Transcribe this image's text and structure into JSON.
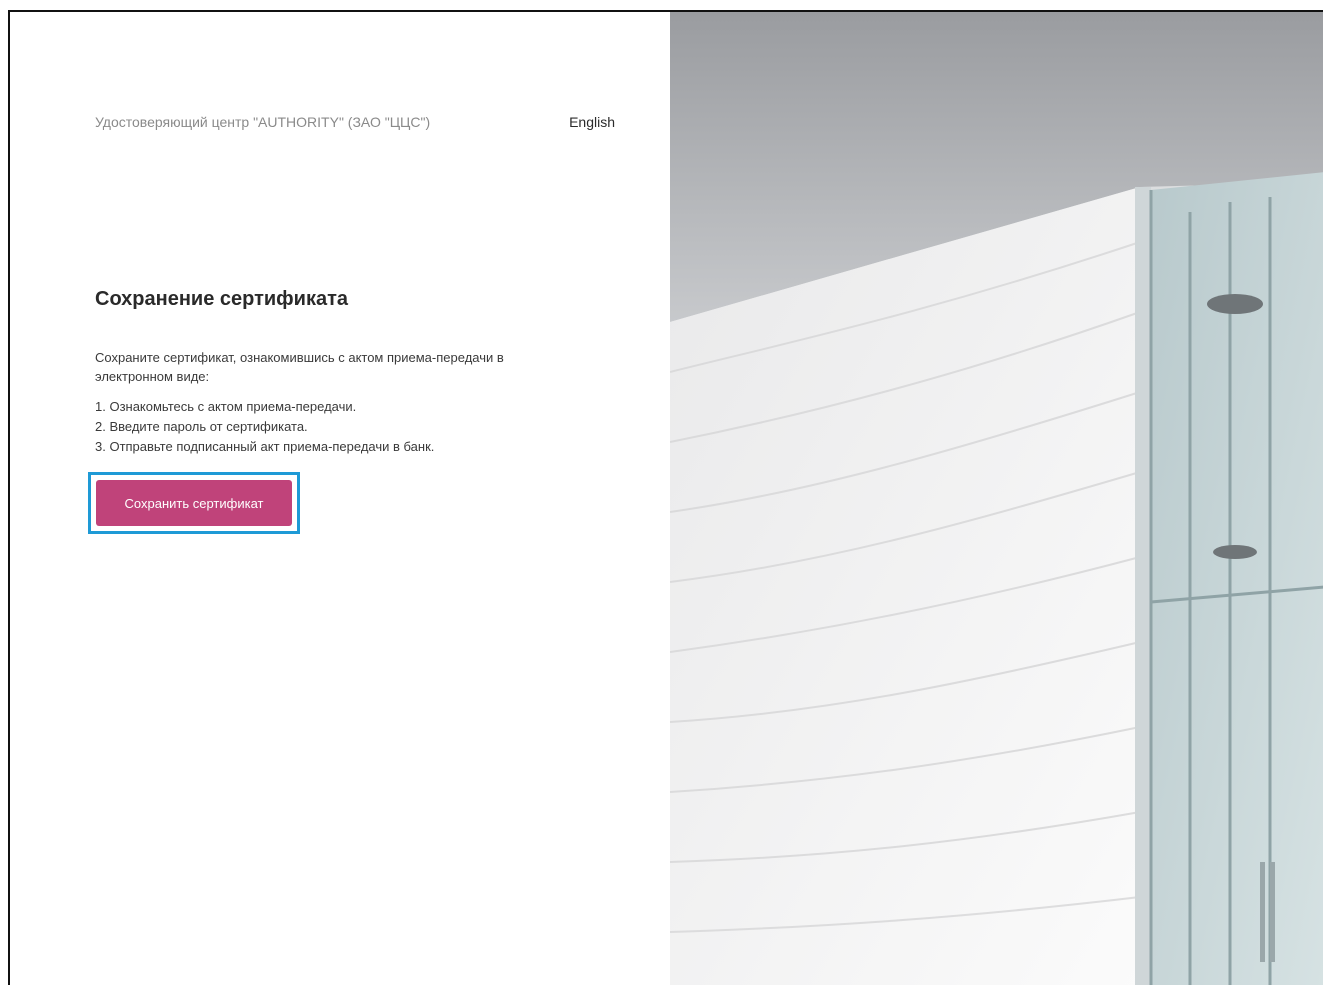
{
  "header": {
    "org_name": "Удостоверяющий центр \"AUTHORITY\" (ЗАО \"ЦЦС\")",
    "language_link": "English"
  },
  "main": {
    "title": "Сохранение сертификата",
    "description": "Сохраните сертификат, ознакомившись с актом приема-передачи в электронном виде:",
    "steps": [
      "1. Ознакомьтесь с актом приема-передачи.",
      "2. Введите пароль от сертификата.",
      "3. Отправьте подписанный акт приема-передачи в банк."
    ],
    "save_button_label": "Сохранить сертификат"
  },
  "colors": {
    "button": "#c0437a",
    "highlight": "#1e9ad6"
  }
}
